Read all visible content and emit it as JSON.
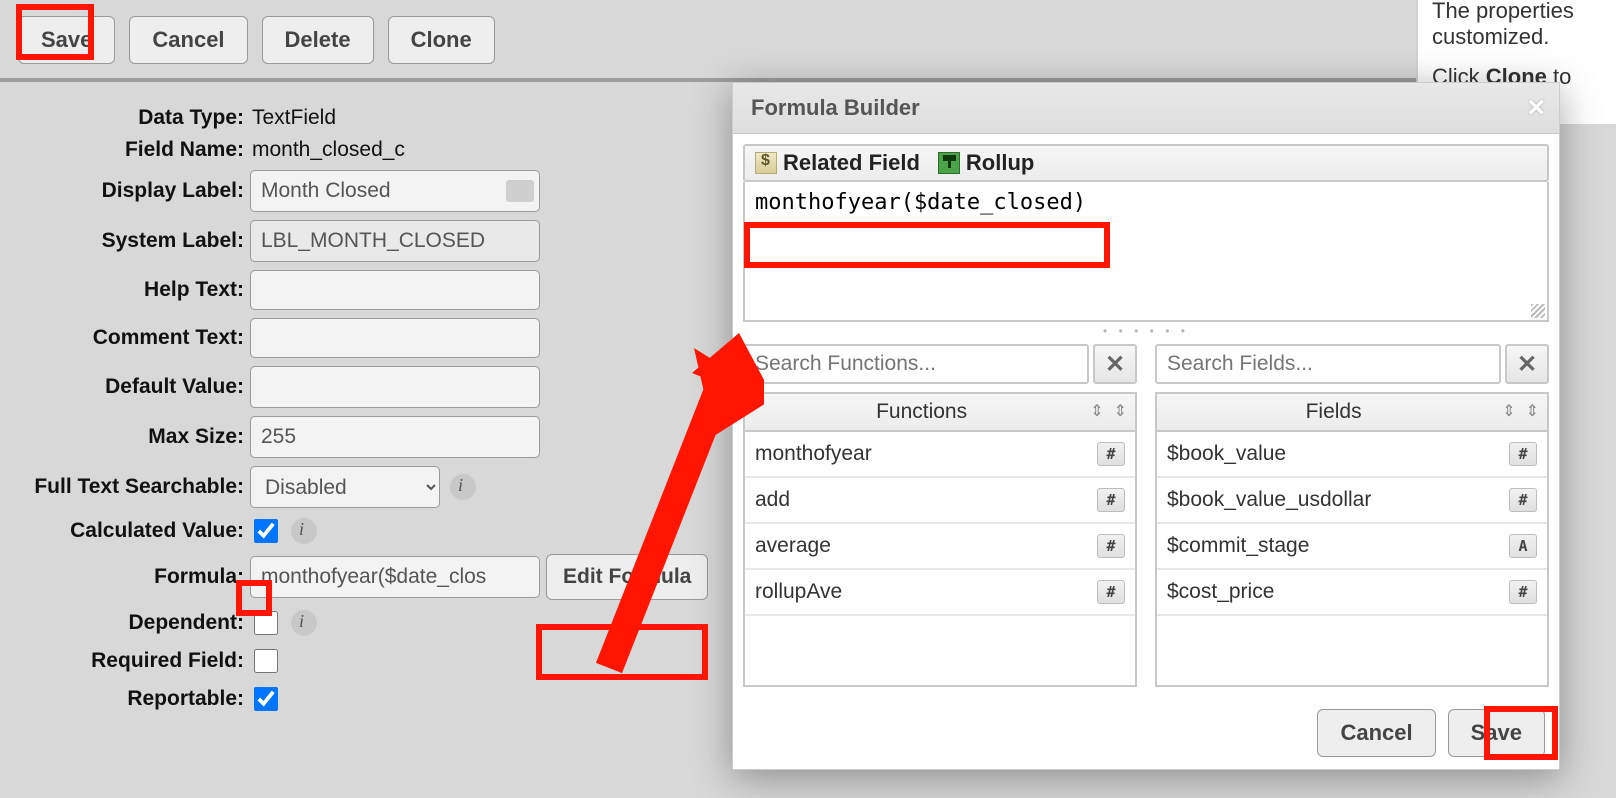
{
  "toolbar": {
    "save": "Save",
    "cancel": "Cancel",
    "delete": "Delete",
    "clone": "Clone"
  },
  "side": {
    "line1": "The properties",
    "line2": "customized.",
    "line3a": "Click ",
    "line3b": "Clone",
    "line3c": " to"
  },
  "form": {
    "data_type": {
      "label": "Data Type:",
      "value": "TextField"
    },
    "field_name": {
      "label": "Field Name:",
      "value": "month_closed_c"
    },
    "display_label": {
      "label": "Display Label:",
      "value": "Month Closed"
    },
    "system_label": {
      "label": "System Label:",
      "value": "LBL_MONTH_CLOSED"
    },
    "help_text": {
      "label": "Help Text:",
      "value": ""
    },
    "comment_text": {
      "label": "Comment Text:",
      "value": ""
    },
    "default_value": {
      "label": "Default Value:",
      "value": ""
    },
    "max_size": {
      "label": "Max Size:",
      "value": "255"
    },
    "full_text": {
      "label": "Full Text Searchable:",
      "value": "Disabled"
    },
    "calculated": {
      "label": "Calculated Value:",
      "checked": true
    },
    "formula": {
      "label": "Formula:",
      "value": "monthofyear($date_closed)",
      "display": "monthofyear($date_clos",
      "edit": "Edit Formula"
    },
    "dependent": {
      "label": "Dependent:",
      "checked": false
    },
    "required": {
      "label": "Required Field:",
      "checked": false
    },
    "reportable": {
      "label": "Reportable:",
      "checked": true
    }
  },
  "dialog": {
    "title": "Formula Builder",
    "tabs": {
      "related": "Related Field",
      "rollup": "Rollup"
    },
    "formula": "monthofyear($date_closed)",
    "functions": {
      "search_placeholder": "Search Functions...",
      "header": "Functions",
      "rows": [
        {
          "name": "monthofyear",
          "type": "#"
        },
        {
          "name": "add",
          "type": "#"
        },
        {
          "name": "average",
          "type": "#"
        },
        {
          "name": "rollupAve",
          "type": "#"
        }
      ]
    },
    "fields": {
      "search_placeholder": "Search Fields...",
      "header": "Fields",
      "rows": [
        {
          "name": "$book_value",
          "type": "#"
        },
        {
          "name": "$book_value_usdollar",
          "type": "#"
        },
        {
          "name": "$commit_stage",
          "type": "A"
        },
        {
          "name": "$cost_price",
          "type": "#"
        }
      ]
    },
    "footer": {
      "cancel": "Cancel",
      "save": "Save"
    }
  }
}
